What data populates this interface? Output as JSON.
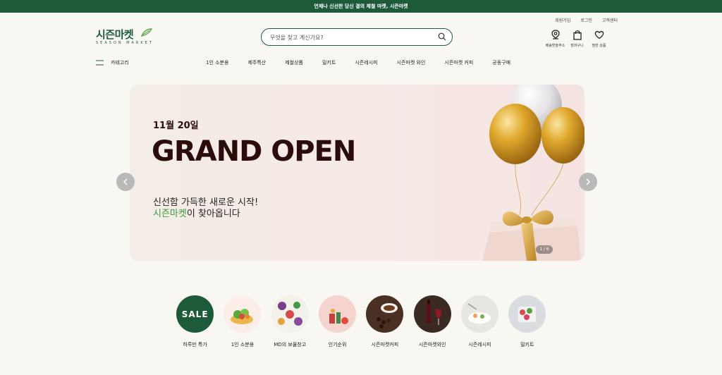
{
  "topbar": {
    "text": "언제나 신선한 당신 곁의 제철 마켓, 시즌마켓"
  },
  "util_links": [
    "회원가입",
    "로그인",
    "고객센터"
  ],
  "logo": {
    "title": "시즌마켓",
    "subtitle": "SEASON MARKET"
  },
  "search": {
    "placeholder": "무엇을 찾고 계신가요?"
  },
  "header_icons": [
    {
      "label": "배송받을주소",
      "icon": "location-pin-icon"
    },
    {
      "label": "장바구니",
      "icon": "shopping-bag-icon"
    },
    {
      "label": "찜한 상품",
      "icon": "heart-icon"
    }
  ],
  "nav": {
    "category_label": "카테고리",
    "items": [
      "1인 소분용",
      "제주특산",
      "제철상품",
      "밀키트",
      "시즌레시피",
      "시즌마켓 와인",
      "시즌마켓 커피",
      "공동구매"
    ]
  },
  "banner": {
    "date": "11월 20일",
    "title": "GRAND OPEN",
    "desc_line1": "신선함 가득한 새로운 시작!",
    "desc_highlight": "시즌마켓",
    "desc_line2_rest": "이 찾아옵니다",
    "pager": "1 / 6",
    "highlight_color": "#3a9a3a"
  },
  "quick_categories": [
    {
      "label": "하루만 특가",
      "badge": "SALE"
    },
    {
      "label": "1인 소분용"
    },
    {
      "label": "MD의 보물창고"
    },
    {
      "label": "인기순위"
    },
    {
      "label": "시즌마켓커피"
    },
    {
      "label": "시즌마켓와인"
    },
    {
      "label": "시즌레시피"
    },
    {
      "label": "밀키트"
    }
  ],
  "colors": {
    "brand": "#1d5a3a",
    "background": "#f8f7f2"
  }
}
